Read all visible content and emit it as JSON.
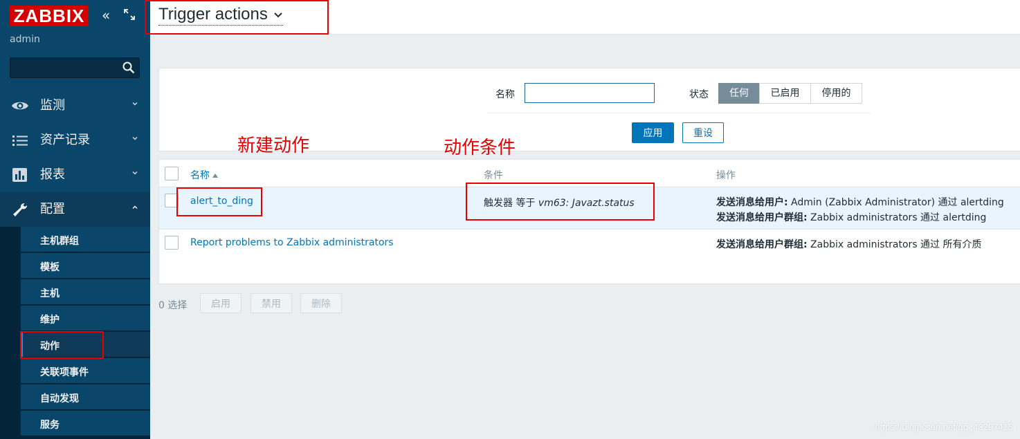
{
  "sidebar": {
    "logo": "ZABBIX",
    "user": "admin",
    "search_placeholder": "",
    "menu": [
      {
        "label": "监测"
      },
      {
        "label": "资产记录"
      },
      {
        "label": "报表"
      },
      {
        "label": "配置"
      }
    ],
    "submenu": [
      {
        "label": "主机群组"
      },
      {
        "label": "模板"
      },
      {
        "label": "主机"
      },
      {
        "label": "维护"
      },
      {
        "label": "动作"
      },
      {
        "label": "关联项事件"
      },
      {
        "label": "自动发现"
      },
      {
        "label": "服务"
      }
    ]
  },
  "header": {
    "title": "Trigger actions"
  },
  "filter": {
    "name_label": "名称",
    "name_value": "",
    "status_label": "状态",
    "status_options": [
      "任何",
      "已启用",
      "停用的"
    ],
    "status_selected": "任何",
    "apply": "应用",
    "reset": "重设"
  },
  "annotations": {
    "new_action": "新建动作",
    "action_condition": "动作条件"
  },
  "table": {
    "headers": {
      "name": "名称",
      "conditions": "条件",
      "operations": "操作"
    },
    "rows": [
      {
        "name": "alert_to_ding",
        "condition_prefix": "触发器 等于 ",
        "condition_value": "vm63: Javazt.status",
        "operations": [
          {
            "label": "发送消息给用户:",
            "text": " Admin (Zabbix Administrator) 通过 alertding"
          },
          {
            "label": "发送消息给用户群组:",
            "text": " Zabbix administrators 通过 alertding"
          }
        ]
      },
      {
        "name": "Report problems to Zabbix administrators",
        "condition_prefix": "",
        "condition_value": "",
        "operations": [
          {
            "label": "发送消息给用户群组:",
            "text": " Zabbix administrators 通过 所有介质"
          }
        ]
      }
    ]
  },
  "footer": {
    "selected": "0 选择",
    "enable": "启用",
    "disable": "禁用",
    "delete": "删除"
  },
  "watermark": "https://blog.csdn.net/qq_43297415",
  "colors": {
    "sidebar_bg": "#0a466a",
    "logo_red": "#d40000",
    "link_blue": "#0275b8",
    "annotation_red": "#e80000",
    "selected_segment": "#768d99"
  }
}
